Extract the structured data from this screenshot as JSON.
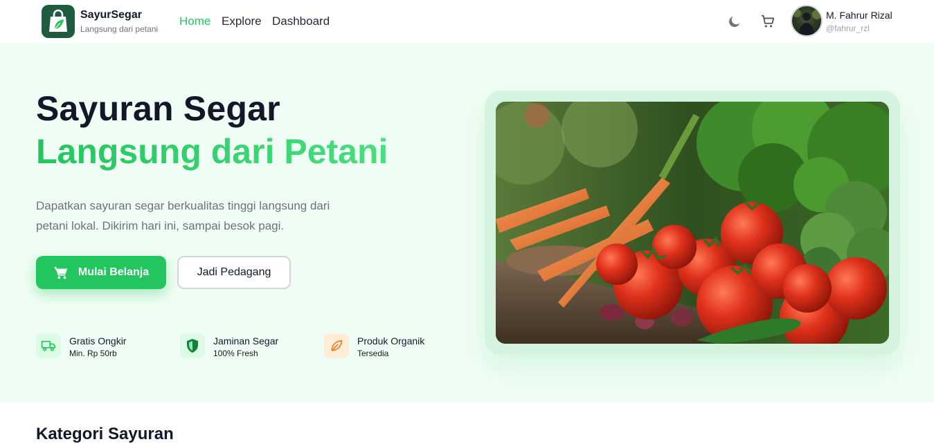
{
  "brand": {
    "name": "SayurSegar",
    "tagline": "Langsung dari petani"
  },
  "nav": [
    {
      "label": "Home",
      "active": true
    },
    {
      "label": "Explore",
      "active": false
    },
    {
      "label": "Dashboard",
      "active": false
    }
  ],
  "header_icons": [
    "moon-icon",
    "cart-icon"
  ],
  "user": {
    "name": "M. Fahrur Rizal",
    "handle": "@fahrur_rzl"
  },
  "hero": {
    "title_line1": "Sayuran Segar",
    "title_line2": "Langsung dari Petani",
    "description": "Dapatkan sayuran segar berkualitas tinggi langsung dari petani lokal. Dikirim hari ini, sampai besok pagi.",
    "primary_button": "Mulai Belanja",
    "secondary_button": "Jadi Pedagang",
    "features": [
      {
        "title": "Gratis Ongkir",
        "subtitle": "Min. Rp 50rb",
        "icon": "truck-icon",
        "color": "#22c55e",
        "bg": "#dcfce7"
      },
      {
        "title": "Jaminan Segar",
        "subtitle": "100% Fresh",
        "icon": "shield-icon",
        "color": "#15803d",
        "bg": "#dcfce7"
      },
      {
        "title": "Produk Organik",
        "subtitle": "Tersedia",
        "icon": "leaf-icon",
        "color": "#f97316",
        "bg": "#ffedd5"
      }
    ]
  },
  "section": {
    "title": "Kategori Sayuran"
  },
  "colors": {
    "accent": "#22c55e",
    "hero_bg": "#f0fdf4",
    "logo_bg": "#1f5b3f"
  }
}
